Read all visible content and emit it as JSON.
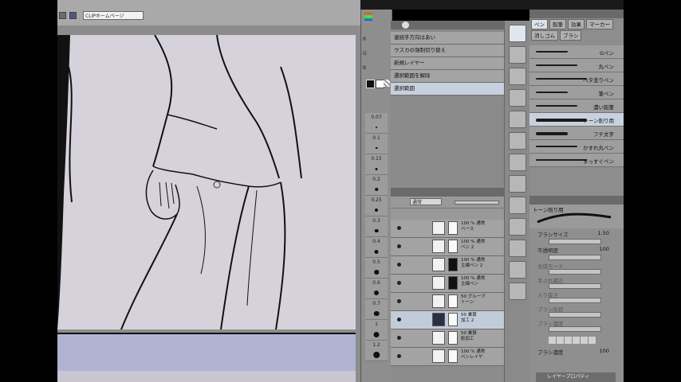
{
  "topbar": {
    "home_label": "CLIPホームページ"
  },
  "history": {
    "items": [
      "連続手方向はあい",
      "ウスカの強制切り替え",
      "新規レイヤー",
      "選択範囲を解除",
      "選択範囲"
    ],
    "selected_index": 4
  },
  "rgb": {
    "r": "R",
    "g": "G",
    "b": "B"
  },
  "brush_sizes": [
    "0.07",
    "0.1",
    "0.15",
    "0.2",
    "0.25",
    "0.3",
    "0.4",
    "0.5",
    "0.6",
    "0.7",
    "1",
    "1.2"
  ],
  "layers": {
    "blend_mode": "通常",
    "rows": [
      {
        "label": "100 % 通常\nベース"
      },
      {
        "label": "100 % 通常\nペン 2"
      },
      {
        "label": "100 % 通常\n主線ペン 2"
      },
      {
        "label": "100 % 通常\n主線ペン"
      },
      {
        "label": "50 グループ\nトーン"
      },
      {
        "label": "50 乗算\n加工 2"
      },
      {
        "label": "50 乗算\n影加工"
      },
      {
        "label": "100 % 通常\nペンレイヤ"
      }
    ],
    "selected_index": 5
  },
  "subtool": {
    "tabs": [
      "ペン",
      "鉛筆",
      "効果",
      "マーカー",
      "消しゴム",
      "ブラシ"
    ],
    "brushes": [
      "Gペン",
      "丸ペン",
      "ベタ塗りペン",
      "筆ペン",
      "濃い鉛筆",
      "トーン削り用",
      "フチ文字",
      "かすれ丸ペン",
      "まっすぐペン"
    ],
    "selected_index": 5
  },
  "props": {
    "brush_name": "トーン削り用",
    "size_label": "ブラシサイズ",
    "size_value": "1.50",
    "opacity_label": "不透明度",
    "opacity_value": "100",
    "rows": [
      "合成モード",
      "手ぶれ補正",
      "入り抜き",
      "ブラシ形状",
      "ブラシ濃度"
    ],
    "density_label": "ブラシ濃度",
    "density_value": "100"
  },
  "bottom_panel": {
    "title": "レイヤープロパティ"
  }
}
